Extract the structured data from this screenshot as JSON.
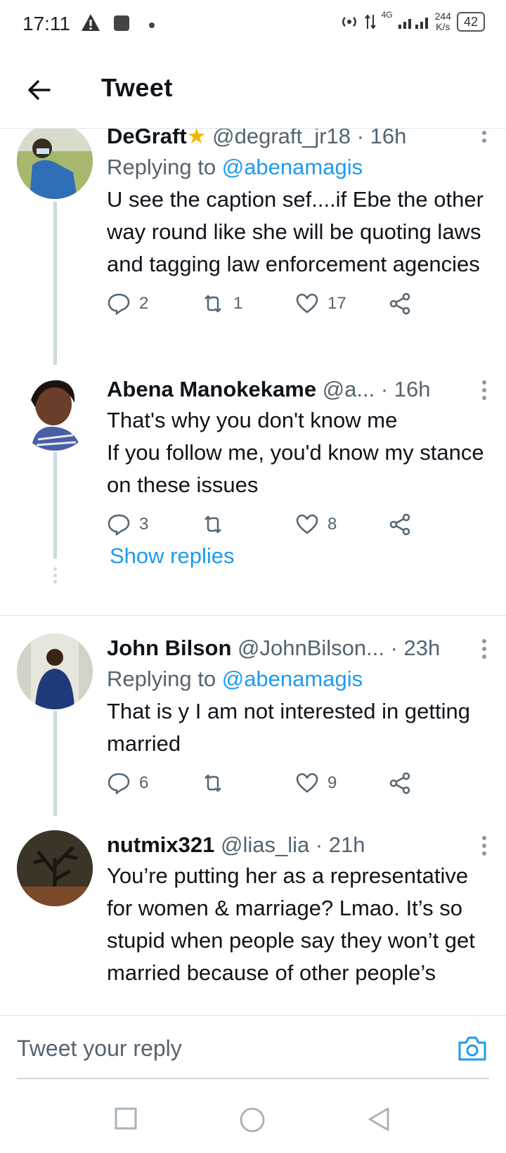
{
  "status_bar": {
    "time": "17:11",
    "network": "4G",
    "net_speed_value": "244",
    "net_speed_unit": "K/s",
    "battery": "42"
  },
  "header": {
    "title": "Tweet"
  },
  "tweets": [
    {
      "name": "DeGraft",
      "handle": "@degraft_jr18",
      "time": "· 16h",
      "replying_prefix": "Replying to ",
      "replying_to": "@abenamagis",
      "text": "U see the caption sef....if Ebe the other way round like she will be quoting laws and tagging law enforcement agencies",
      "replies": "2",
      "retweets": "1",
      "likes": "17"
    },
    {
      "name": "Abena Manokekame",
      "handle": "@a...",
      "time": "· 16h",
      "text": "That's why you don't know me\nIf you follow me, you'd know my stance on these issues",
      "replies": "3",
      "retweets": "",
      "likes": "8"
    },
    {
      "name": "John Bilson",
      "handle": "@JohnBilson...",
      "time": "· 23h",
      "replying_prefix": "Replying to ",
      "replying_to": "@abenamagis",
      "text": "That is y I am not interested in getting married",
      "replies": "6",
      "retweets": "",
      "likes": "9"
    },
    {
      "name": "nutmix321",
      "handle": "@lias_lia",
      "time": "· 21h",
      "text": "You’re putting her as a representative for women & marriage? Lmao. It’s so stupid when people say they won’t get married because of other people’s"
    }
  ],
  "show_replies": "Show replies",
  "reply_bar": {
    "placeholder": "Tweet your reply"
  },
  "colors": {
    "accent": "#1d9bf0",
    "text": "#0f1419",
    "muted": "#536471"
  }
}
